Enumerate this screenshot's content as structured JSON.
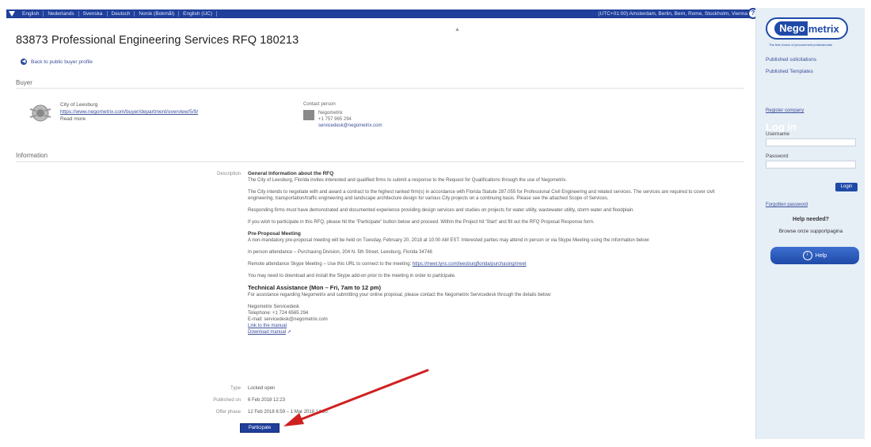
{
  "topbar": {
    "languages": [
      "English",
      "Nederlands",
      "Svenska",
      "Deutsch",
      "Norsk (Bokmål)",
      "English (UC)"
    ],
    "timezone": "(UTC+01:00) Amsterdam, Berlin, Bern, Rome, Stockholm, Vienna",
    "help_label": "?"
  },
  "page": {
    "title": "83873 Professional Engineering Services RFQ 180213",
    "back_link": "Back to public buyer profile",
    "collapse": "▲"
  },
  "buyer": {
    "heading": "Buyer",
    "org_name": "City of Leesburg",
    "org_url": "https://www.negometrix.com/buyer/department/overview/5/9/",
    "org_extra": "Read more",
    "contact_label": "Contact person",
    "contact_name": "Negometrix",
    "contact_phone": "+1 757 965 294",
    "contact_email": "servicedesk@negometrix.com"
  },
  "info": {
    "heading": "Information",
    "labels": {
      "description": "Description",
      "type": "Type",
      "published": "Published on",
      "offer_phase": "Offer phase"
    },
    "general_title": "General Information about the RFQ",
    "general_p1": "The City of Leesburg, Florida invites interested and qualified firms to submit a response to the Request for Qualifications through the use of Negometrix.",
    "general_p2": "The City intends to negotiate with and award a contract to the highest ranked firm(s) in accordance with Florida Statute 287.055 for Professional Civil Engineering and related services. The services are required to cover civil engineering, transportation/traffic engineering and landscape architecture design for various City projects on a continuing basis. Please see the attached Scope of Services.",
    "general_p3": "Responding firms must have demonstrated and documented experience providing design services and studies on projects for water utility, wastewater utility, storm water and floodplain.",
    "general_p4": "If you wish to participate in this RFQ, please hit the \"Participate\" button below and proceed. Within the Project hit 'Start' and fill out the RFQ Proposal Response form.",
    "preproposal_title": "Pre-Proposal Meeting",
    "preproposal_p1": "A non-mandatory pre-proposal meeting will be held on Tuesday, February 20, 2018 at 10:00 AM EST. Interested parties may attend in person or via Skype Meeting using the information below:",
    "preproposal_p2": "In person attendance – Purchasing Division, 204 N. 5th Street, Leesburg, Florida 34748",
    "preproposal_p3": "Remote attendance Skype Meeting – Use this URL to connect to the meeting:",
    "preproposal_link": "https://meet.lync.com/leesburgflorida/purchasing/meet",
    "preproposal_p4": "You may need to download and install the Skype add-on prior to the meeting in order to participate.",
    "assist_title": "Technical Assistance (Mon – Fri, 7am to 12 pm)",
    "assist_p1": "For assistance regarding Negometrix and submitting your online proposal, please contact the Negometrix Servicedesk through the details below:",
    "assist_name": "Negometrix Servicedesk",
    "assist_phone": "Telephone: +1 724 6565 294",
    "assist_email": "E-mail: servicedesk@negometrix.com",
    "assist_manual": "Link to the manual",
    "assist_docs": "Download manual",
    "type_value": "Locked open",
    "published_value": "6 Feb 2018 12:23",
    "offer_value": "12 Feb 2018 6:59 – 1 Mar 2018 14:30"
  },
  "participate_label": "Participate",
  "sidebar": {
    "logo_a": "Nego",
    "logo_b": "metrix",
    "tagline": "The first choice of procurement professionals",
    "links": [
      "Published solicitations",
      "Published Templates"
    ],
    "register": "Register company",
    "login_heading": "Log in",
    "username_label": "Username",
    "password_label": "Password",
    "login_button": "Login",
    "forgot": "Forgotten password",
    "help_needed": "Help needed?",
    "help_sub": "Browse onze supportpagina",
    "help_button": "Help"
  },
  "colors": {
    "brand": "#1f4aa8",
    "topbar": "#1f3f9a",
    "arrow": "#d02020",
    "sidebar_bg": "#e6eef6"
  }
}
